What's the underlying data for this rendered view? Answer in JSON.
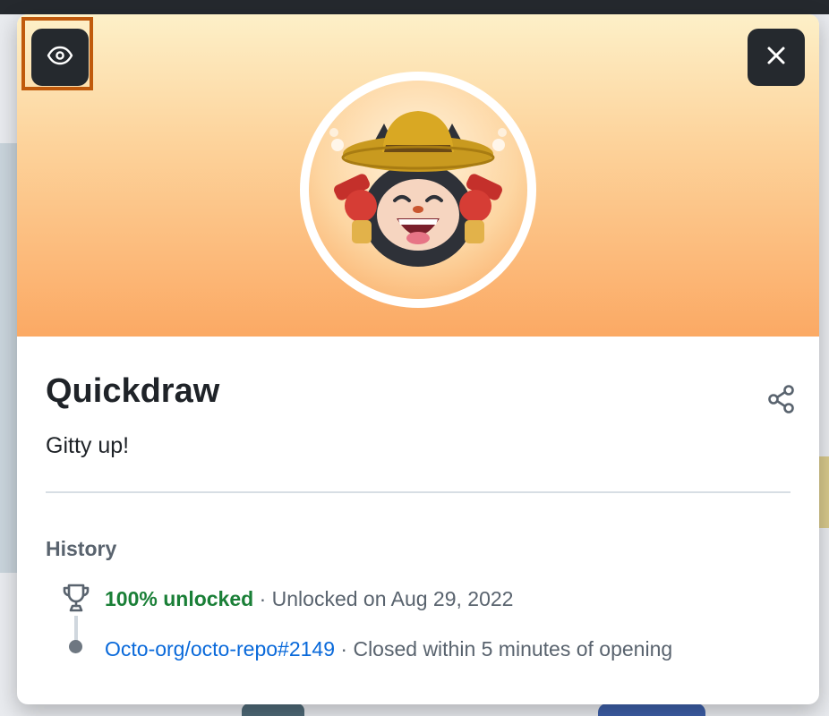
{
  "dialog": {
    "title": "Quickdraw",
    "description": "Gitty up!",
    "history_heading": "History",
    "buttons": {
      "toggle_visibility": "eye-icon",
      "close": "close-icon",
      "share": "share-icon"
    },
    "history": [
      {
        "icon": "trophy-icon",
        "highlight": "100% unlocked",
        "separator": " · ",
        "detail": "Unlocked on Aug 29, 2022"
      },
      {
        "icon": "dot-icon",
        "link": "Octo-org/octo-repo#2149",
        "separator": " · ",
        "detail": "Closed within 5 minutes of opening"
      }
    ]
  },
  "colors": {
    "success": "#1a7f37",
    "link": "#0969da",
    "focus": "#c05a0c",
    "button_bg": "#25292e"
  }
}
